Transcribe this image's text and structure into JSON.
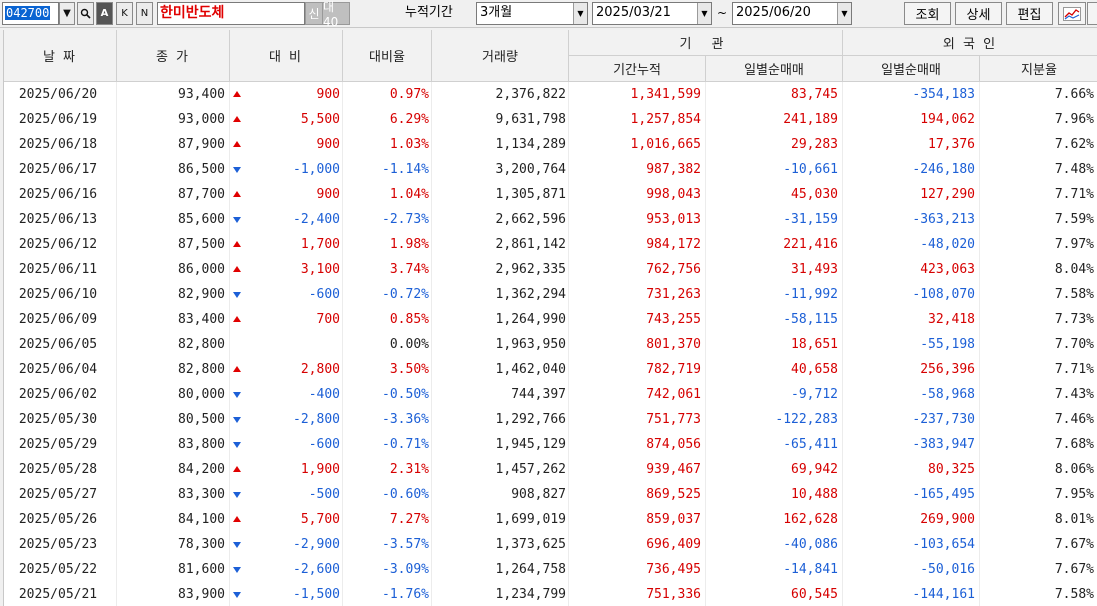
{
  "toolbar": {
    "code": "042700",
    "name": "한미반도체",
    "sin_label": "신",
    "dae_label": "대40",
    "k_label": "K",
    "n_label": "N",
    "period_label": "누적기간",
    "period_value": "3개월",
    "from_date": "2025/03/21",
    "tilde": "~",
    "to_date": "2025/06/20",
    "query_label": "조회",
    "detail_label": "상세",
    "edit_label": "편집"
  },
  "headers": {
    "date": "날 짜",
    "close": "종 가",
    "diff": "대 비",
    "rate": "대비율",
    "volume": "거래량",
    "institution": "기 관",
    "inst_cum": "기간누적",
    "inst_day": "일별순매매",
    "foreign": "외 국 인",
    "for_day": "일별순매매",
    "for_share": "지분율"
  },
  "colors": {
    "up": "#d60000",
    "down": "#1c5fd6"
  },
  "rows": [
    {
      "date": "2025/06/20",
      "close": "93,400",
      "dir": "up",
      "diff": "900",
      "rate": "0.97%",
      "volume": "2,376,822",
      "inst_cum": "1,341,599",
      "inst_day": "83,745",
      "for_day": "-354,183",
      "share": "7.66%"
    },
    {
      "date": "2025/06/19",
      "close": "93,000",
      "dir": "up",
      "diff": "5,500",
      "rate": "6.29%",
      "volume": "9,631,798",
      "inst_cum": "1,257,854",
      "inst_day": "241,189",
      "for_day": "194,062",
      "share": "7.96%"
    },
    {
      "date": "2025/06/18",
      "close": "87,900",
      "dir": "up",
      "diff": "900",
      "rate": "1.03%",
      "volume": "1,134,289",
      "inst_cum": "1,016,665",
      "inst_day": "29,283",
      "for_day": "17,376",
      "share": "7.62%"
    },
    {
      "date": "2025/06/17",
      "close": "86,500",
      "dir": "down",
      "diff": "-1,000",
      "rate": "-1.14%",
      "volume": "3,200,764",
      "inst_cum": "987,382",
      "inst_day": "-10,661",
      "for_day": "-246,180",
      "share": "7.48%"
    },
    {
      "date": "2025/06/16",
      "close": "87,700",
      "dir": "up",
      "diff": "900",
      "rate": "1.04%",
      "volume": "1,305,871",
      "inst_cum": "998,043",
      "inst_day": "45,030",
      "for_day": "127,290",
      "share": "7.71%"
    },
    {
      "date": "2025/06/13",
      "close": "85,600",
      "dir": "down",
      "diff": "-2,400",
      "rate": "-2.73%",
      "volume": "2,662,596",
      "inst_cum": "953,013",
      "inst_day": "-31,159",
      "for_day": "-363,213",
      "share": "7.59%"
    },
    {
      "date": "2025/06/12",
      "close": "87,500",
      "dir": "up",
      "diff": "1,700",
      "rate": "1.98%",
      "volume": "2,861,142",
      "inst_cum": "984,172",
      "inst_day": "221,416",
      "for_day": "-48,020",
      "share": "7.97%"
    },
    {
      "date": "2025/06/11",
      "close": "86,000",
      "dir": "up",
      "diff": "3,100",
      "rate": "3.74%",
      "volume": "2,962,335",
      "inst_cum": "762,756",
      "inst_day": "31,493",
      "for_day": "423,063",
      "share": "8.04%"
    },
    {
      "date": "2025/06/10",
      "close": "82,900",
      "dir": "down",
      "diff": "-600",
      "rate": "-0.72%",
      "volume": "1,362,294",
      "inst_cum": "731,263",
      "inst_day": "-11,992",
      "for_day": "-108,070",
      "share": "7.58%"
    },
    {
      "date": "2025/06/09",
      "close": "83,400",
      "dir": "up",
      "diff": "700",
      "rate": "0.85%",
      "volume": "1,264,990",
      "inst_cum": "743,255",
      "inst_day": "-58,115",
      "for_day": "32,418",
      "share": "7.73%"
    },
    {
      "date": "2025/06/05",
      "close": "82,800",
      "dir": "none",
      "diff": "",
      "rate": "0.00%",
      "volume": "1,963,950",
      "inst_cum": "801,370",
      "inst_day": "18,651",
      "for_day": "-55,198",
      "share": "7.70%"
    },
    {
      "date": "2025/06/04",
      "close": "82,800",
      "dir": "up",
      "diff": "2,800",
      "rate": "3.50%",
      "volume": "1,462,040",
      "inst_cum": "782,719",
      "inst_day": "40,658",
      "for_day": "256,396",
      "share": "7.71%"
    },
    {
      "date": "2025/06/02",
      "close": "80,000",
      "dir": "down",
      "diff": "-400",
      "rate": "-0.50%",
      "volume": "744,397",
      "inst_cum": "742,061",
      "inst_day": "-9,712",
      "for_day": "-58,968",
      "share": "7.43%"
    },
    {
      "date": "2025/05/30",
      "close": "80,500",
      "dir": "down",
      "diff": "-2,800",
      "rate": "-3.36%",
      "volume": "1,292,766",
      "inst_cum": "751,773",
      "inst_day": "-122,283",
      "for_day": "-237,730",
      "share": "7.46%"
    },
    {
      "date": "2025/05/29",
      "close": "83,800",
      "dir": "down",
      "diff": "-600",
      "rate": "-0.71%",
      "volume": "1,945,129",
      "inst_cum": "874,056",
      "inst_day": "-65,411",
      "for_day": "-383,947",
      "share": "7.68%"
    },
    {
      "date": "2025/05/28",
      "close": "84,200",
      "dir": "up",
      "diff": "1,900",
      "rate": "2.31%",
      "volume": "1,457,262",
      "inst_cum": "939,467",
      "inst_day": "69,942",
      "for_day": "80,325",
      "share": "8.06%"
    },
    {
      "date": "2025/05/27",
      "close": "83,300",
      "dir": "down",
      "diff": "-500",
      "rate": "-0.60%",
      "volume": "908,827",
      "inst_cum": "869,525",
      "inst_day": "10,488",
      "for_day": "-165,495",
      "share": "7.95%"
    },
    {
      "date": "2025/05/26",
      "close": "84,100",
      "dir": "up",
      "diff": "5,700",
      "rate": "7.27%",
      "volume": "1,699,019",
      "inst_cum": "859,037",
      "inst_day": "162,628",
      "for_day": "269,900",
      "share": "8.01%"
    },
    {
      "date": "2025/05/23",
      "close": "78,300",
      "dir": "down",
      "diff": "-2,900",
      "rate": "-3.57%",
      "volume": "1,373,625",
      "inst_cum": "696,409",
      "inst_day": "-40,086",
      "for_day": "-103,654",
      "share": "7.67%"
    },
    {
      "date": "2025/05/22",
      "close": "81,600",
      "dir": "down",
      "diff": "-2,600",
      "rate": "-3.09%",
      "volume": "1,264,758",
      "inst_cum": "736,495",
      "inst_day": "-14,841",
      "for_day": "-50,016",
      "share": "7.67%"
    },
    {
      "date": "2025/05/21",
      "close": "83,900",
      "dir": "down",
      "diff": "-1,500",
      "rate": "-1.76%",
      "volume": "1,234,799",
      "inst_cum": "751,336",
      "inst_day": "60,545",
      "for_day": "-144,161",
      "share": "7.58%"
    }
  ]
}
